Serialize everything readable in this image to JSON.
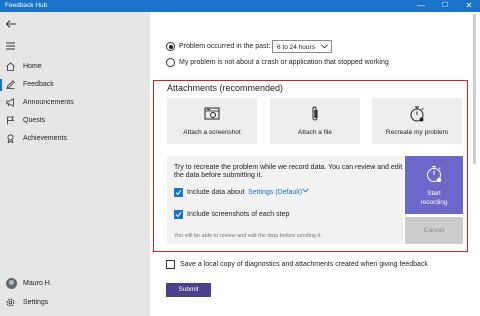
{
  "window": {
    "title": "Feedback Hub",
    "minimize_glyph": "—",
    "maximize_glyph": "☐",
    "close_glyph": "✕"
  },
  "sidebar": {
    "items": [
      {
        "label": "Home",
        "icon": "home-icon"
      },
      {
        "label": "Feedback",
        "icon": "feedback-icon"
      },
      {
        "label": "Announcements",
        "icon": "announcements-icon"
      },
      {
        "label": "Quests",
        "icon": "quests-icon"
      },
      {
        "label": "Achievements",
        "icon": "achievements-icon"
      }
    ],
    "active_index": 1,
    "user_name": "Mauro H.",
    "settings_label": "Settings"
  },
  "problem": {
    "occurred_label": "Problem occurred in the past:",
    "occurred_value": "6 to 24 hours",
    "not_crash_label": "My problem is not about a crash or application that stopped working"
  },
  "attachments": {
    "title": "Attachments (recommended)",
    "tiles": [
      {
        "label": "Attach a screenshot",
        "icon": "screenshot-icon"
      },
      {
        "label": "Attach a file",
        "icon": "paperclip-icon"
      },
      {
        "label": "Recreate my problem",
        "icon": "stopwatch-icon"
      }
    ],
    "instructions_line1": "Try to recreate the problem while we record data. You can review and edit",
    "instructions_line2": "the data before submitting it.",
    "include_data_label": "Include data about",
    "include_data_value": "Settings (Default)",
    "include_screenshots_label": "Include screenshots of each step",
    "review_note": "You will be able to review and edit the data before sending it.",
    "start_line1": "Start",
    "start_line2": "recording",
    "cancel_label": "Cancel"
  },
  "save_copy_label": "Save a local copy of diagnostics and attachments created when giving feedback",
  "submit_label": "Submit",
  "colors": {
    "accent": "#1a73c8",
    "highlight_border": "#d0232b",
    "start_button": "#6b68c9",
    "submit_button": "#4b3f8e"
  }
}
